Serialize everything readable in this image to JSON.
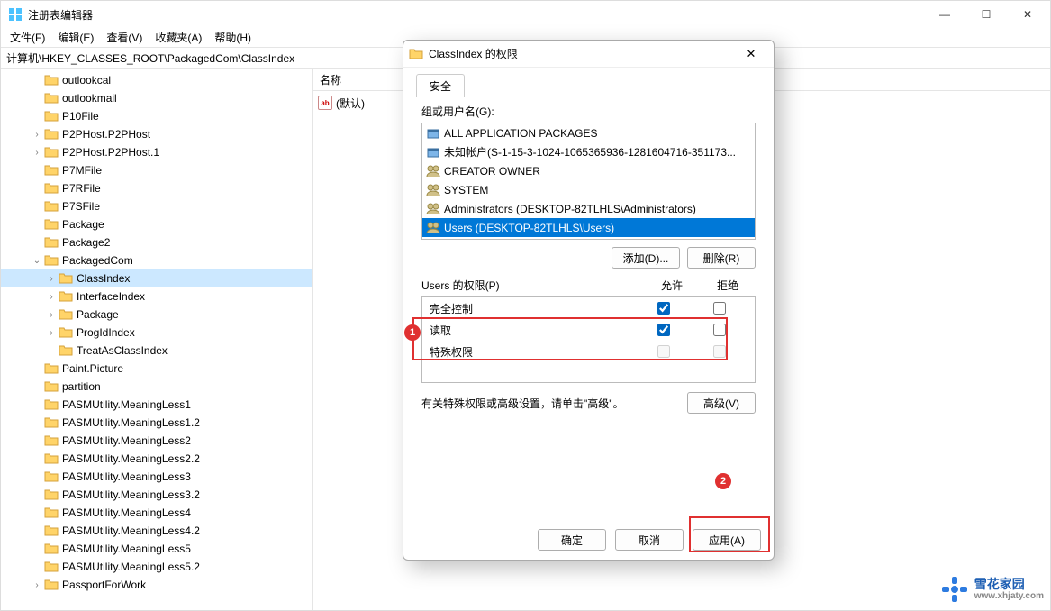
{
  "window": {
    "title": "注册表编辑器",
    "min": "—",
    "max": "☐",
    "close": "✕"
  },
  "menu": {
    "file": "文件(F)",
    "edit": "编辑(E)",
    "view": "查看(V)",
    "favorites": "收藏夹(A)",
    "help": "帮助(H)"
  },
  "address": "计算机\\HKEY_CLASSES_ROOT\\PackagedCom\\ClassIndex",
  "tree": [
    {
      "indent": 2,
      "chevron": "",
      "label": "outlookcal"
    },
    {
      "indent": 2,
      "chevron": "",
      "label": "outlookmail"
    },
    {
      "indent": 2,
      "chevron": "",
      "label": "P10File"
    },
    {
      "indent": 2,
      "chevron": ">",
      "label": "P2PHost.P2PHost"
    },
    {
      "indent": 2,
      "chevron": ">",
      "label": "P2PHost.P2PHost.1"
    },
    {
      "indent": 2,
      "chevron": "",
      "label": "P7MFile"
    },
    {
      "indent": 2,
      "chevron": "",
      "label": "P7RFile"
    },
    {
      "indent": 2,
      "chevron": "",
      "label": "P7SFile"
    },
    {
      "indent": 2,
      "chevron": "",
      "label": "Package"
    },
    {
      "indent": 2,
      "chevron": "",
      "label": "Package2"
    },
    {
      "indent": 2,
      "chevron": "v",
      "label": "PackagedCom"
    },
    {
      "indent": 3,
      "chevron": ">",
      "label": "ClassIndex",
      "selected": true
    },
    {
      "indent": 3,
      "chevron": ">",
      "label": "InterfaceIndex"
    },
    {
      "indent": 3,
      "chevron": ">",
      "label": "Package"
    },
    {
      "indent": 3,
      "chevron": ">",
      "label": "ProgIdIndex"
    },
    {
      "indent": 3,
      "chevron": "",
      "label": "TreatAsClassIndex"
    },
    {
      "indent": 2,
      "chevron": "",
      "label": "Paint.Picture"
    },
    {
      "indent": 2,
      "chevron": "",
      "label": "partition"
    },
    {
      "indent": 2,
      "chevron": "",
      "label": "PASMUtility.MeaningLess1"
    },
    {
      "indent": 2,
      "chevron": "",
      "label": "PASMUtility.MeaningLess1.2"
    },
    {
      "indent": 2,
      "chevron": "",
      "label": "PASMUtility.MeaningLess2"
    },
    {
      "indent": 2,
      "chevron": "",
      "label": "PASMUtility.MeaningLess2.2"
    },
    {
      "indent": 2,
      "chevron": "",
      "label": "PASMUtility.MeaningLess3"
    },
    {
      "indent": 2,
      "chevron": "",
      "label": "PASMUtility.MeaningLess3.2"
    },
    {
      "indent": 2,
      "chevron": "",
      "label": "PASMUtility.MeaningLess4"
    },
    {
      "indent": 2,
      "chevron": "",
      "label": "PASMUtility.MeaningLess4.2"
    },
    {
      "indent": 2,
      "chevron": "",
      "label": "PASMUtility.MeaningLess5"
    },
    {
      "indent": 2,
      "chevron": "",
      "label": "PASMUtility.MeaningLess5.2"
    },
    {
      "indent": 2,
      "chevron": ">",
      "label": "PassportForWork"
    }
  ],
  "list": {
    "colName": "名称",
    "defaultValue": "(默认)"
  },
  "dialog": {
    "title": "ClassIndex 的权限",
    "tab": "安全",
    "groupLabel": "组或用户名(G):",
    "users": [
      {
        "label": "ALL APPLICATION PACKAGES",
        "type": "pkg"
      },
      {
        "label": "未知帐户(S-1-15-3-1024-1065365936-1281604716-351173...",
        "type": "pkg"
      },
      {
        "label": "CREATOR OWNER",
        "type": "grp"
      },
      {
        "label": "SYSTEM",
        "type": "grp"
      },
      {
        "label": "Administrators (DESKTOP-82TLHLS\\Administrators)",
        "type": "grp"
      },
      {
        "label": "Users (DESKTOP-82TLHLS\\Users)",
        "type": "grp",
        "selected": true
      }
    ],
    "addBtn": "添加(D)...",
    "removeBtn": "删除(R)",
    "permHeader": "Users 的权限(P)",
    "colAllow": "允许",
    "colDeny": "拒绝",
    "perms": [
      {
        "name": "完全控制",
        "allow": true,
        "deny": false
      },
      {
        "name": "读取",
        "allow": true,
        "deny": false
      },
      {
        "name": "特殊权限",
        "allow": false,
        "deny": false,
        "disabled": true
      }
    ],
    "hint": "有关特殊权限或高级设置，请单击\"高级\"。",
    "advancedBtn": "高级(V)",
    "ok": "确定",
    "cancel": "取消",
    "apply": "应用(A)"
  },
  "callouts": {
    "c1": "1",
    "c2": "2"
  },
  "watermark": {
    "cn": "雪花家园",
    "url": "www.xhjaty.com"
  }
}
